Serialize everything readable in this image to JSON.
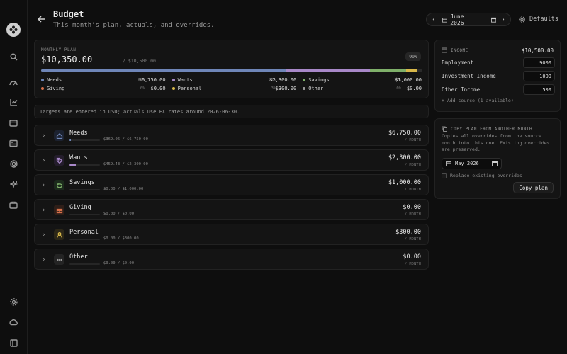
{
  "header": {
    "title": "Budget",
    "subtitle": "This month's plan, actuals, and overrides.",
    "month": "June 2026",
    "defaults_label": "Defaults"
  },
  "plan": {
    "label": "MONTHLY PLAN",
    "total": "$10,350.00",
    "of_income": "/ $10,500.00",
    "percent_badge": "99%",
    "categories": [
      {
        "name": "Needs",
        "percent": "64%",
        "amount": "$6,750.00",
        "color": "#6f86b8",
        "share": 0.643
      },
      {
        "name": "Wants",
        "percent": "22%",
        "amount": "$2,300.00",
        "color": "#a888c8",
        "share": 0.219
      },
      {
        "name": "Savings",
        "percent": "10%",
        "amount": "$1,000.00",
        "color": "#7fb06a",
        "share": 0.095
      },
      {
        "name": "Giving",
        "percent": "0%",
        "amount": "$0.00",
        "color": "#d6704a",
        "share": 0
      },
      {
        "name": "Personal",
        "percent": "3%",
        "amount": "$300.00",
        "color": "#d8b84a",
        "share": 0.029
      },
      {
        "name": "Other",
        "percent": "0%",
        "amount": "$0.00",
        "color": "#9a9a9a",
        "share": 0
      }
    ]
  },
  "fx_note": "Targets are entered in USD; actuals use FX rates around 2026-06-30.",
  "category_rows": [
    {
      "name": "Needs",
      "spent": "$369.06 / $6,750.00",
      "amount": "$6,750.00",
      "per": "/ MONTH",
      "progress": 0.055,
      "color": "#6f86b8",
      "icon": "home-icon",
      "bg": "#1c2230"
    },
    {
      "name": "Wants",
      "spent": "$459.43 / $2,300.00",
      "amount": "$2,300.00",
      "per": "/ MONTH",
      "progress": 0.2,
      "color": "#a888c8",
      "icon": "tag-icon",
      "bg": "#241d2c"
    },
    {
      "name": "Savings",
      "spent": "$0.00 / $1,000.00",
      "amount": "$1,000.00",
      "per": "/ MONTH",
      "progress": 0,
      "color": "#7fb06a",
      "icon": "piggy-bank-icon",
      "bg": "#1c2a1c"
    },
    {
      "name": "Giving",
      "spent": "$0.00 / $0.00",
      "amount": "$0.00",
      "per": "/ MONTH",
      "progress": 0,
      "color": "#d6704a",
      "icon": "gift-icon",
      "bg": "#2e1e18"
    },
    {
      "name": "Personal",
      "spent": "$0.00 / $300.00",
      "amount": "$300.00",
      "per": "/ MONTH",
      "progress": 0,
      "color": "#d8b84a",
      "icon": "user-icon",
      "bg": "#2c2718"
    },
    {
      "name": "Other",
      "spent": "$0.00 / $0.00",
      "amount": "$0.00",
      "per": "/ MONTH",
      "progress": 0,
      "color": "#9a9a9a",
      "icon": "more-icon",
      "bg": "#242424"
    }
  ],
  "income": {
    "label": "INCOME",
    "total": "$10,500.00",
    "sources": [
      {
        "name": "Employment",
        "value": "9000"
      },
      {
        "name": "Investment Income",
        "value": "1000"
      },
      {
        "name": "Other Income",
        "value": "500"
      }
    ],
    "add_source": "+ Add source (1 available)"
  },
  "copy_plan": {
    "label": "COPY PLAN FROM ANOTHER MONTH",
    "description": "Copies all overrides from the source month into this one. Existing overrides are preserved.",
    "month": "May 2026",
    "replace_label": "Replace existing overrides",
    "button": "Copy plan"
  }
}
